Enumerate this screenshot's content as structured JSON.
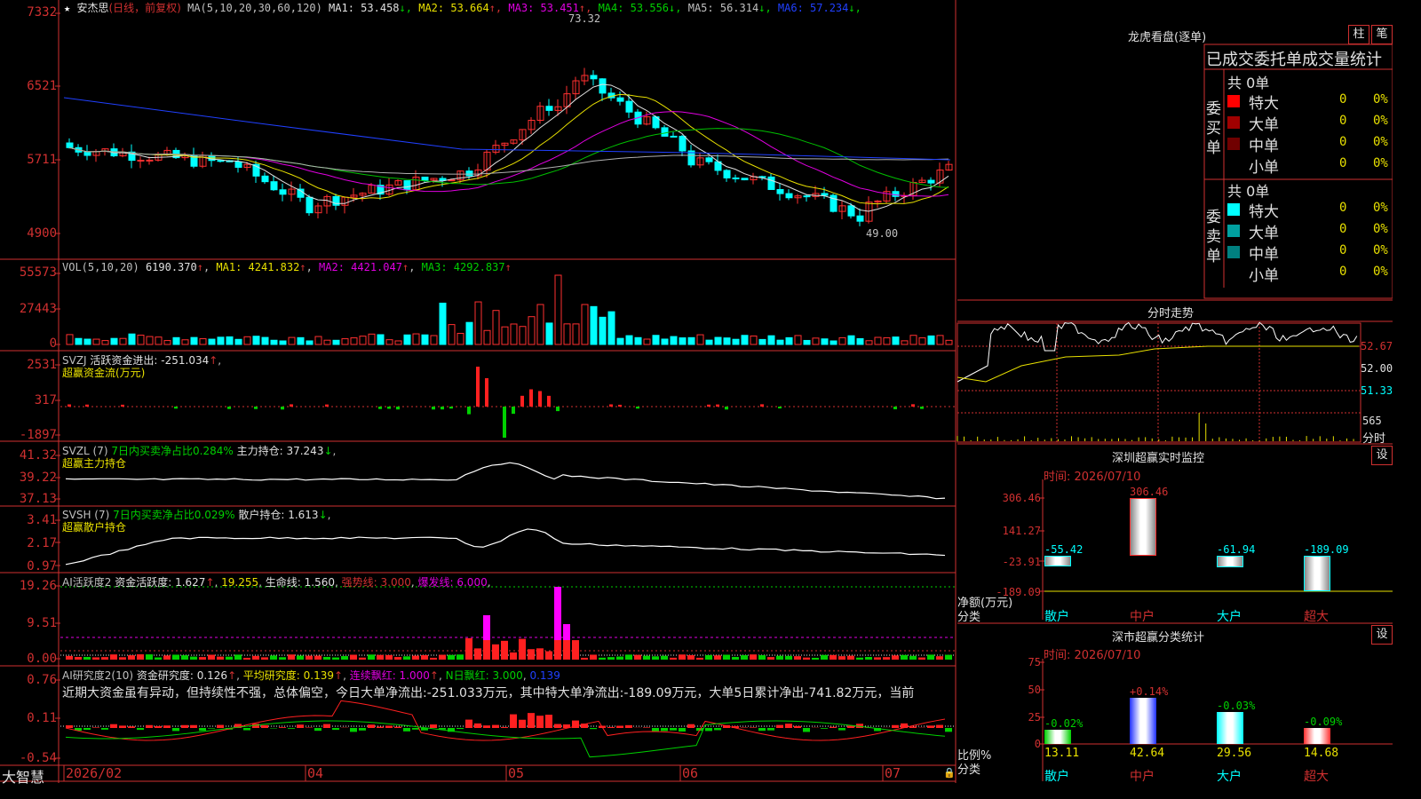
{
  "stock": {
    "star_icon": "★",
    "name": "安杰思",
    "period": "(日线，前复权)"
  },
  "price_panel": {
    "ma_param": "MA(5,10,20,30,60,120)",
    "ma_values": [
      {
        "label": "MA1:",
        "value": "53.458",
        "arrow": "↓",
        "color": "#e0e0e0"
      },
      {
        "label": "MA2:",
        "value": "53.664",
        "arrow": "↑",
        "color": "#e8e000"
      },
      {
        "label": "MA3:",
        "value": "53.451",
        "arrow": "↑",
        "color": "#e000e0"
      },
      {
        "label": "MA4:",
        "value": "53.556",
        "arrow": "↓",
        "color": "#00d000"
      },
      {
        "label": "MA5:",
        "value": "56.314",
        "arrow": "↓",
        "color": "#c0c0c0"
      },
      {
        "label": "MA6:",
        "value": "57.234",
        "arrow": "↓",
        "color": "#2040ff"
      }
    ],
    "y_labels": [
      "7332",
      "6521",
      "5711",
      "4900"
    ],
    "high_label": "73.32",
    "low_label": "49.00"
  },
  "vol_panel": {
    "title": "VOL(5,10,20)",
    "value": "6190.370",
    "ma1": "4241.832",
    "ma2": "4421.047",
    "ma3": "4292.837",
    "y_labels": [
      "55573",
      "27443",
      "0"
    ]
  },
  "svzj_panel": {
    "title": "SVZJ",
    "line1": "活跃资金进出: -251.034",
    "line2": "超赢资金流(万元)",
    "y_labels": [
      "2531",
      "317",
      "-1897"
    ]
  },
  "svzl_panel": {
    "title": "SVZL (7)",
    "desc": "7日内买卖净占比0.284%",
    "hold": "主力持仓: 37.243",
    "line2": "超赢主力持仓",
    "y_labels": [
      "41.32",
      "39.22",
      "37.13"
    ]
  },
  "svsh_panel": {
    "title": "SVSH (7)",
    "desc": "7日内买卖净占比0.029%",
    "hold": "散户持仓: 1.613",
    "line2": "超赢散户持仓",
    "y_labels": [
      "3.41",
      "2.17",
      "0.97"
    ]
  },
  "ai_active_panel": {
    "title": "AI活跃度2",
    "txt": "资金活跃度: 1.627",
    "v2": "19.255",
    "life": "生命线: 1.560",
    "strong": "强势线: 3.000",
    "burst": "爆发线: 6.000",
    "y_labels": [
      "19.26",
      "9.51",
      "0.00"
    ]
  },
  "ai_research_panel": {
    "title": "AI研究度2(10)",
    "research": "资金研究度: 0.126",
    "avg": "平均研究度: 0.139",
    "lianxu": "连续飘红: 1.000",
    "nday": "N日飘红: 3.000",
    "last": "0.139",
    "comment": "近期大资金虽有异动，但持续性不强，总体偏空，今日大单净流出:-251.033万元，其中特大单净流出:-189.09万元，大单5日累计净出-741.82万元，当前",
    "y_labels": [
      "0.76",
      "0.11",
      "-0.54"
    ]
  },
  "x_axis": {
    "labels": [
      "2026/02",
      "04",
      "05",
      "06",
      "07"
    ],
    "brand": "大智慧"
  },
  "longhu": {
    "title": "龙虎看盘(逐单)",
    "btn1": "柱",
    "btn2": "笔",
    "subtitle": "已成交委托单成交量统计",
    "buy": {
      "label": "委买单",
      "total": "共 0单",
      "rows": [
        {
          "name": "特大",
          "v": "0",
          "p": "0%",
          "c": "#ff0000"
        },
        {
          "name": "大单",
          "v": "0",
          "p": "0%",
          "c": "#a00000"
        },
        {
          "name": "中单",
          "v": "0",
          "p": "0%",
          "c": "#700000"
        },
        {
          "name": "小单",
          "v": "0",
          "p": "0%",
          "c": "#000"
        }
      ]
    },
    "sell": {
      "label": "委卖单",
      "total": "共 0单",
      "rows": [
        {
          "name": "特大",
          "v": "0",
          "p": "0%",
          "c": "#00ffff"
        },
        {
          "name": "大单",
          "v": "0",
          "p": "0%",
          "c": "#00a0a0"
        },
        {
          "name": "中单",
          "v": "0",
          "p": "0%",
          "c": "#008080"
        },
        {
          "name": "小单",
          "v": "0",
          "p": "0%",
          "c": "#000"
        }
      ]
    }
  },
  "timeshare": {
    "title": "分时走势",
    "y_labels": [
      "52.67",
      "52.00",
      "51.33"
    ],
    "vol_label": "565",
    "bottom_label": "分时"
  },
  "monitor": {
    "title": "深圳超赢实时监控",
    "btn": "设",
    "time": "时间: 2026/07/10",
    "y_labels": [
      "306.46",
      "141.27",
      "-23.91",
      "-189.09"
    ],
    "ylabel": "净额(万元)",
    "xlabel": "分类",
    "bars": [
      {
        "name": "散户",
        "value": -55.42,
        "label": "-55.42"
      },
      {
        "name": "中户",
        "value": 306.46,
        "label": "306.46"
      },
      {
        "name": "大户",
        "value": -61.94,
        "label": "-61.94"
      },
      {
        "name": "超大",
        "value": -189.09,
        "label": "-189.09"
      }
    ]
  },
  "classify": {
    "title": "深市超赢分类统计",
    "btn": "设",
    "time": "时间: 2026/07/10",
    "y_labels": [
      "75",
      "50",
      "25",
      "0"
    ],
    "ylabel": "比例%",
    "xlabel": "分类",
    "bars": [
      {
        "name": "散户",
        "value": 13.11,
        "top": "-0.02%",
        "bottom": "13.11"
      },
      {
        "name": "中户",
        "value": 42.64,
        "top": "+0.14%",
        "bottom": "42.64"
      },
      {
        "name": "大户",
        "value": 29.56,
        "top": "-0.03%",
        "bottom": "29.56"
      },
      {
        "name": "超大",
        "value": 14.68,
        "top": "-0.09%",
        "bottom": "14.68"
      }
    ]
  }
}
